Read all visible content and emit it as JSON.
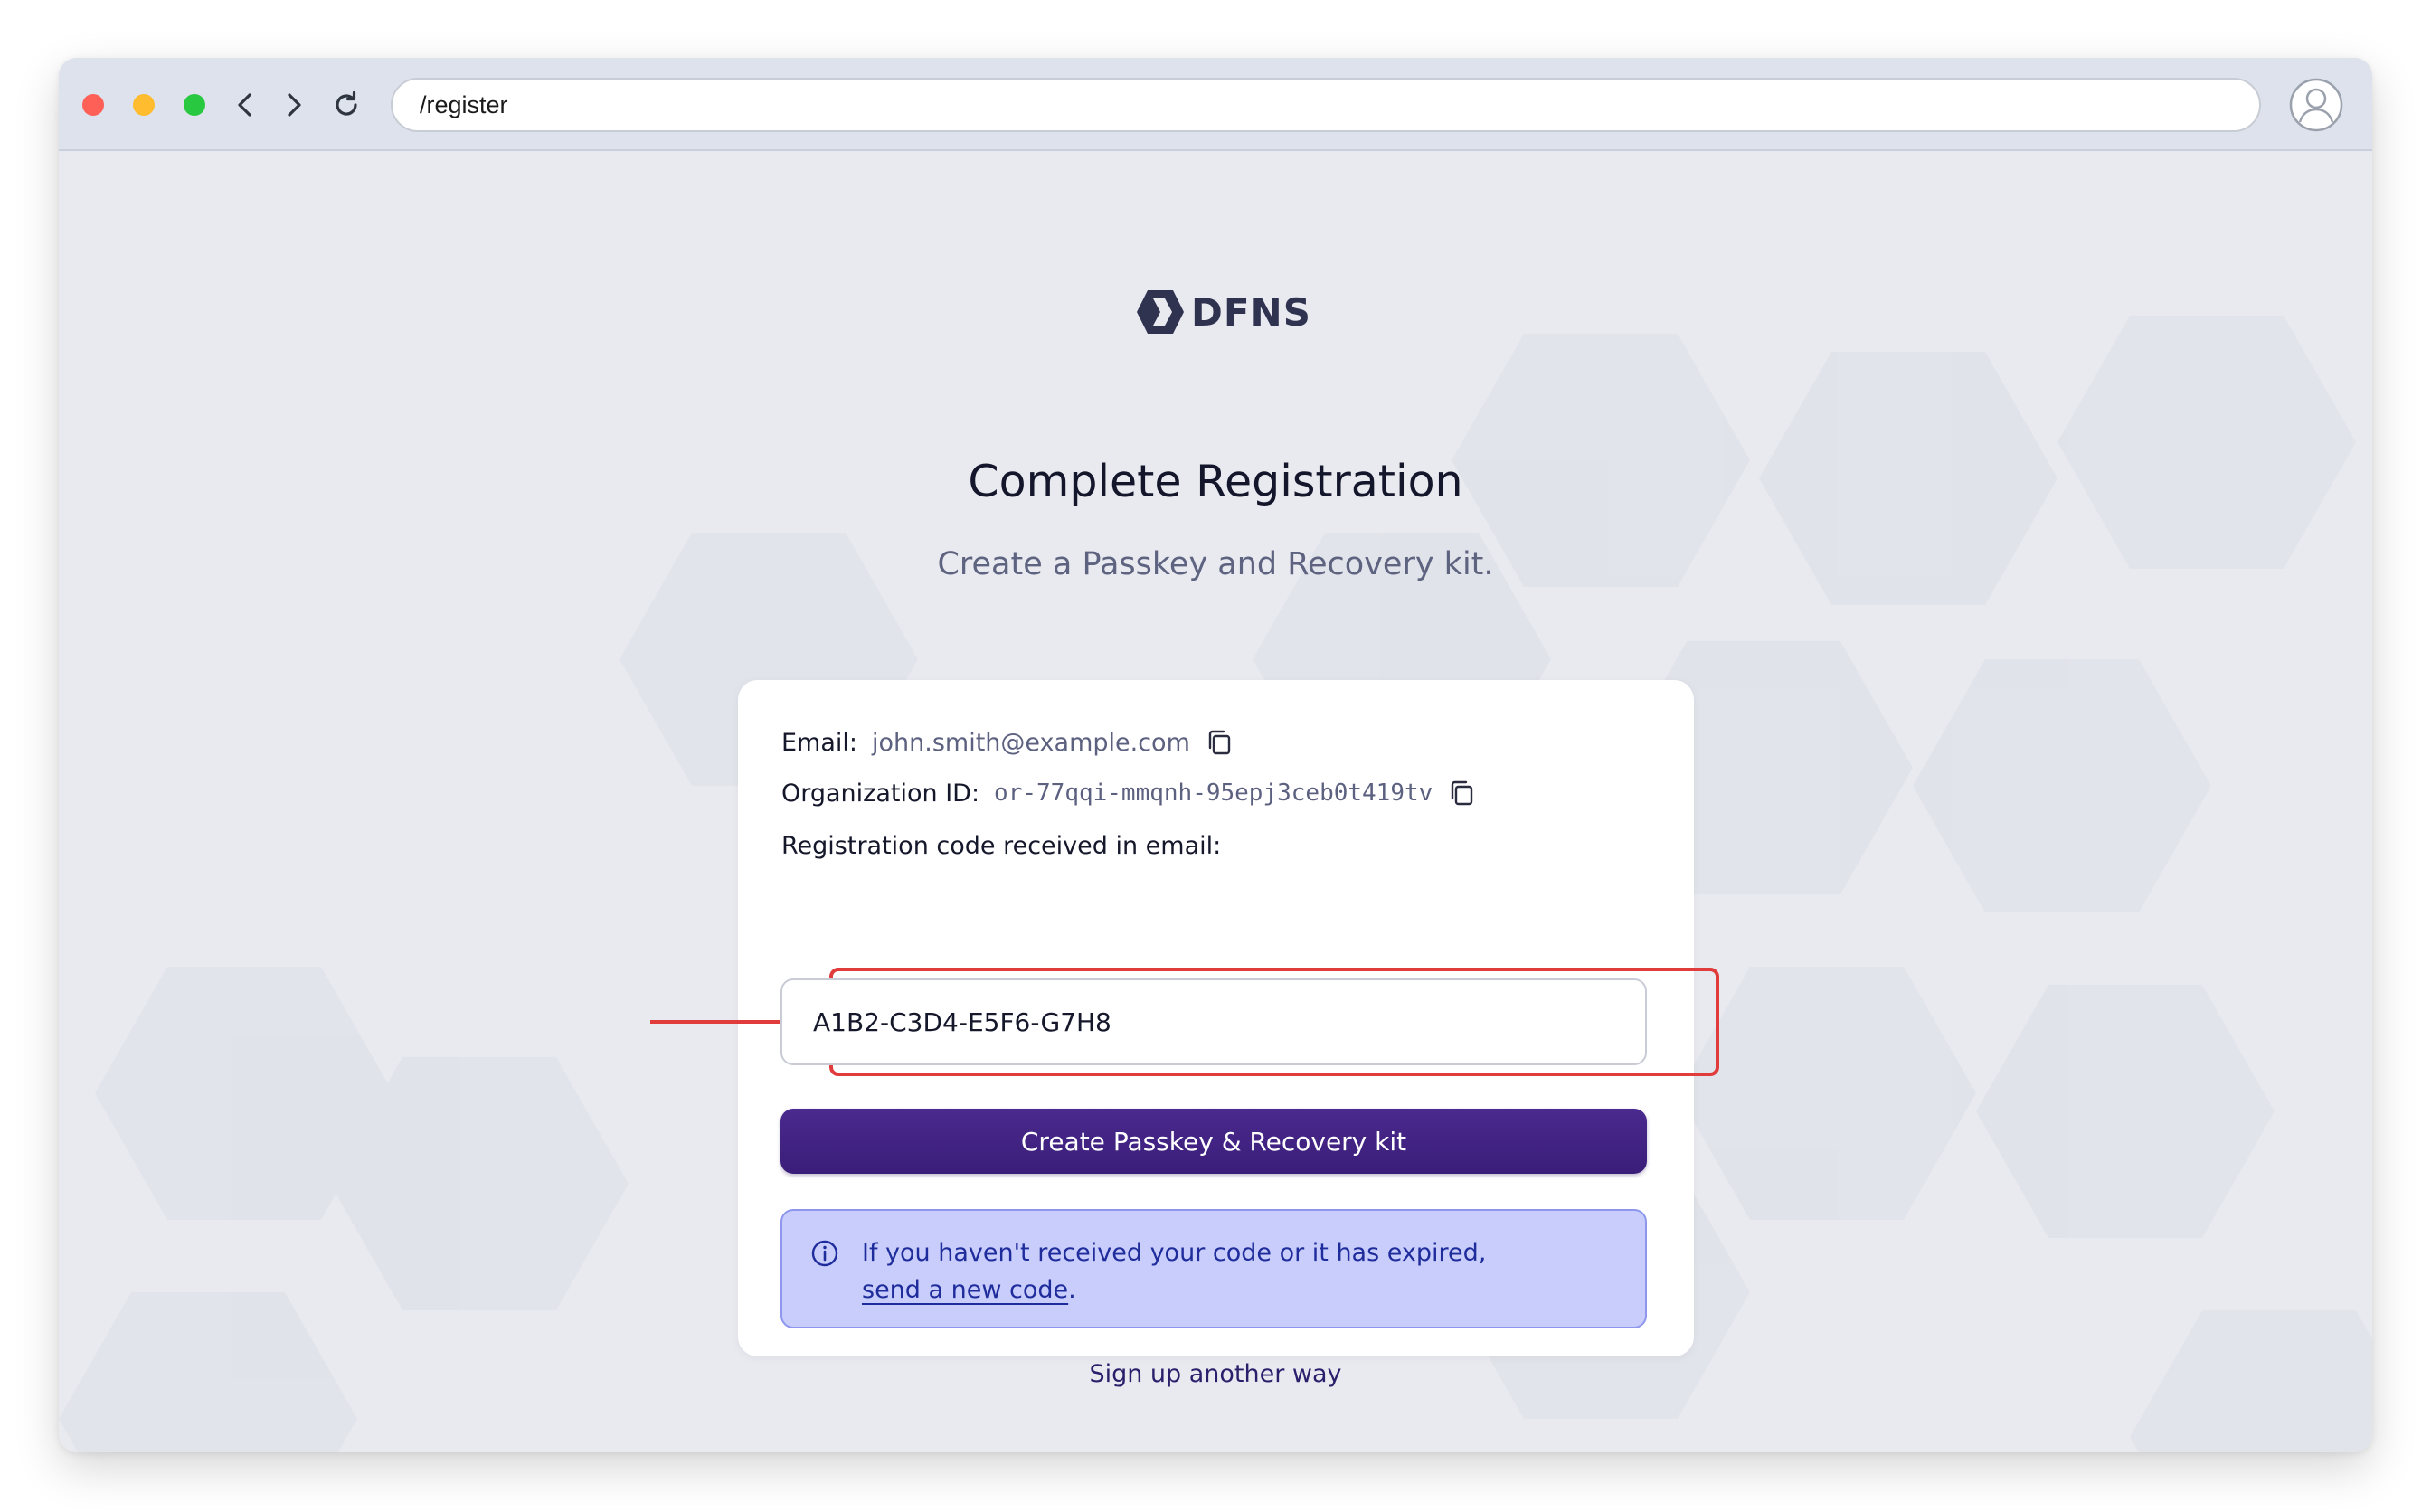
{
  "browser": {
    "url": "/register"
  },
  "brand": {
    "name": "DFNS",
    "color": "#2f3350"
  },
  "page": {
    "title": "Complete Registration",
    "subtitle": "Create a Passkey and Recovery kit."
  },
  "form": {
    "email_label": "Email:",
    "email_value": "john.smith@example.com",
    "org_label": "Organization ID:",
    "org_value": "or-77qqi-mmqnh-95epj3ceb0t419tv",
    "code_label": "Registration code received in email:",
    "code_value": "A1B2-C3D4-E5F6-G7H8",
    "submit_label": "Create Passkey & Recovery kit"
  },
  "info": {
    "text_before": "If you haven't received your code or it has expired,",
    "link_text": "send a new code",
    "text_after": "."
  },
  "alt_signup": "Sign up another way",
  "colors": {
    "primary_button": "#3f2283",
    "info_background": "#c8cdfb",
    "info_text": "#1f2c9c",
    "highlight": "#e03c3c"
  },
  "icons": {
    "copy": "copy-icon",
    "info": "info-icon",
    "profile": "user-avatar-icon"
  }
}
